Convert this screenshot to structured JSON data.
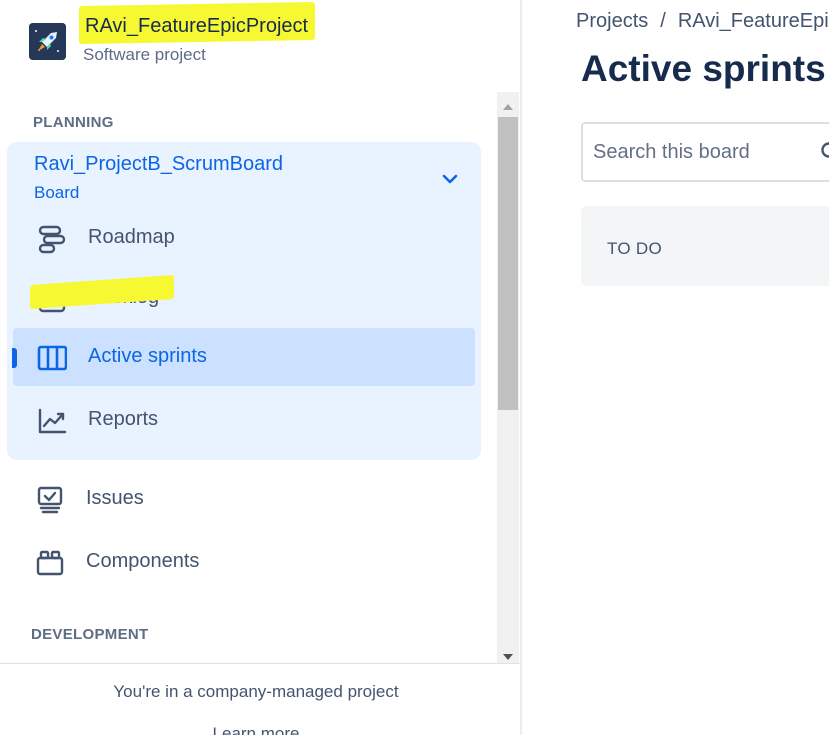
{
  "project": {
    "name": "RAvi_FeatureEpicProject",
    "type": "Software project",
    "avatar_icon": "rocket-icon"
  },
  "sidebar": {
    "planning_heading": "PLANNING",
    "board": {
      "name": "Ravi_ProjectB_ScrumBoard",
      "sub": "Board",
      "expand_icon": "chevron-down-icon",
      "items": [
        {
          "label": "Roadmap",
          "icon": "roadmap-icon"
        },
        {
          "label": "Backlog",
          "icon": "backlog-icon"
        },
        {
          "label": "Active sprints",
          "icon": "board-columns-icon",
          "active": true
        },
        {
          "label": "Reports",
          "icon": "chart-line-icon"
        }
      ]
    },
    "items": [
      {
        "label": "Issues",
        "icon": "issues-icon"
      },
      {
        "label": "Components",
        "icon": "components-icon"
      }
    ],
    "development_heading": "DEVELOPMENT",
    "footer": {
      "text": "You're in a company-managed project",
      "link": "Learn more"
    }
  },
  "main": {
    "breadcrumb": [
      "Projects",
      "RAvi_FeatureEpi"
    ],
    "breadcrumb_separator": "/",
    "title": "Active sprints",
    "search": {
      "placeholder": "Search this board"
    },
    "columns": [
      {
        "title": "TO DO"
      }
    ]
  },
  "colors": {
    "accent": "#0c66e4",
    "highlight": "#f6f931",
    "board_bg": "#e9f2ff",
    "active_bg": "#cce0ff"
  }
}
